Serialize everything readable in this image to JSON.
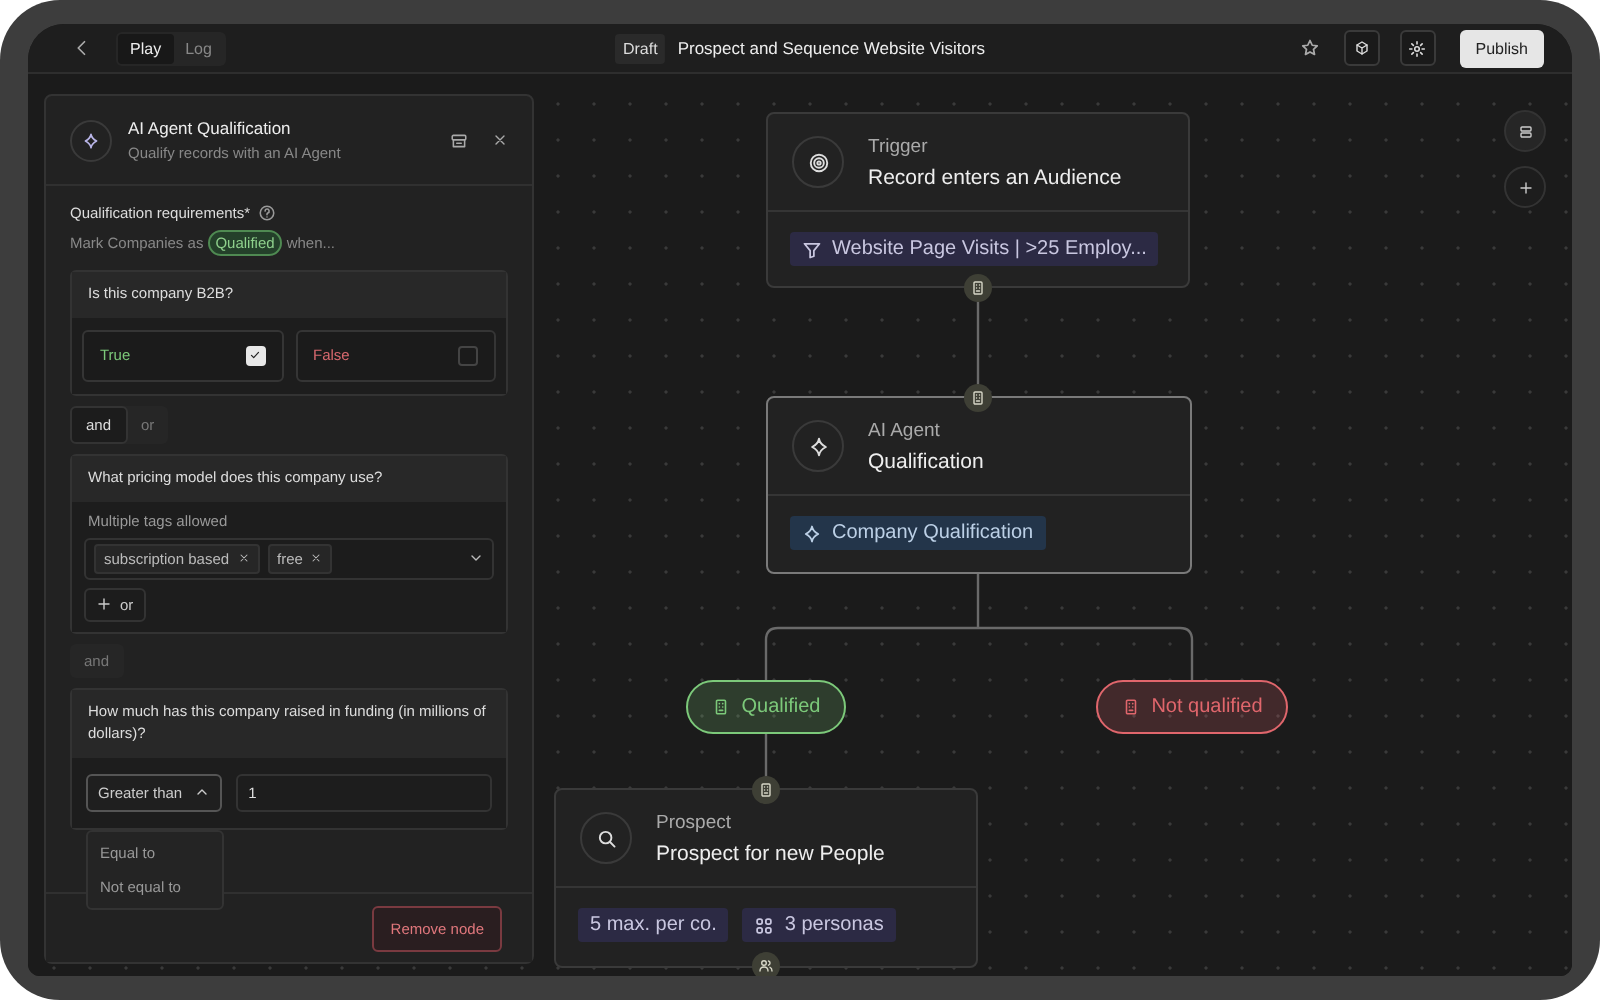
{
  "topbar": {
    "tabs": [
      {
        "label": "Play",
        "selected": true
      },
      {
        "label": "Log",
        "selected": false
      }
    ],
    "status": "Draft",
    "title": "Prospect and Sequence Website Visitors",
    "publish": "Publish"
  },
  "panel": {
    "title": "AI Agent Qualification",
    "subtitle": "Qualify records with an AI Agent",
    "requirements_label": "Qualification requirements*",
    "mark_prefix": "Mark Companies as",
    "mark_tag": "Qualified",
    "mark_suffix": "when...",
    "blocks": [
      {
        "kind": "boolean",
        "question": "Is this company B2B?",
        "options": [
          {
            "label": "True",
            "checked": true,
            "color": "#7cc97a"
          },
          {
            "label": "False",
            "checked": false,
            "color": "#d9696f"
          }
        ]
      },
      {
        "kind": "joiner",
        "options": [
          {
            "label": "and",
            "selected": true
          },
          {
            "label": "or",
            "selected": false
          }
        ]
      },
      {
        "kind": "tags",
        "question": "What pricing model does this company use?",
        "hint": "Multiple tags allowed",
        "tags": [
          "subscription based",
          "free"
        ],
        "add_label": "or"
      },
      {
        "kind": "joiner",
        "options": [
          {
            "label": "and",
            "selected": false
          }
        ]
      },
      {
        "kind": "number",
        "question": "How much has this company raised in funding (in millions of dollars)?",
        "operator": "Greater than",
        "expanded": true,
        "value": "1",
        "choices": [
          "Equal to",
          "Not equal to"
        ]
      }
    ],
    "remove": "Remove node"
  },
  "canvas": {
    "nodes": [
      {
        "kind": "trigger",
        "label": "Trigger",
        "title": "Record enters an Audience",
        "selected": false,
        "chips": [
          {
            "kind": "filter",
            "text": "Website Page Visits | >25 Employ..."
          }
        ]
      },
      {
        "kind": "agent",
        "label": "AI Agent",
        "title": "Qualification",
        "selected": true,
        "chips": [
          {
            "kind": "agent",
            "text": "Company Qualification"
          }
        ]
      },
      {
        "kind": "prospect",
        "label": "Prospect",
        "title": "Prospect for new People",
        "selected": false,
        "chips": [
          {
            "kind": "plain",
            "text": "5 max. per co."
          },
          {
            "kind": "personas",
            "text": "3 personas"
          }
        ]
      }
    ],
    "outcomes": [
      {
        "label": "Qualified",
        "color": "#7cc97a"
      },
      {
        "label": "Not qualified",
        "color": "#e0666c"
      }
    ]
  }
}
